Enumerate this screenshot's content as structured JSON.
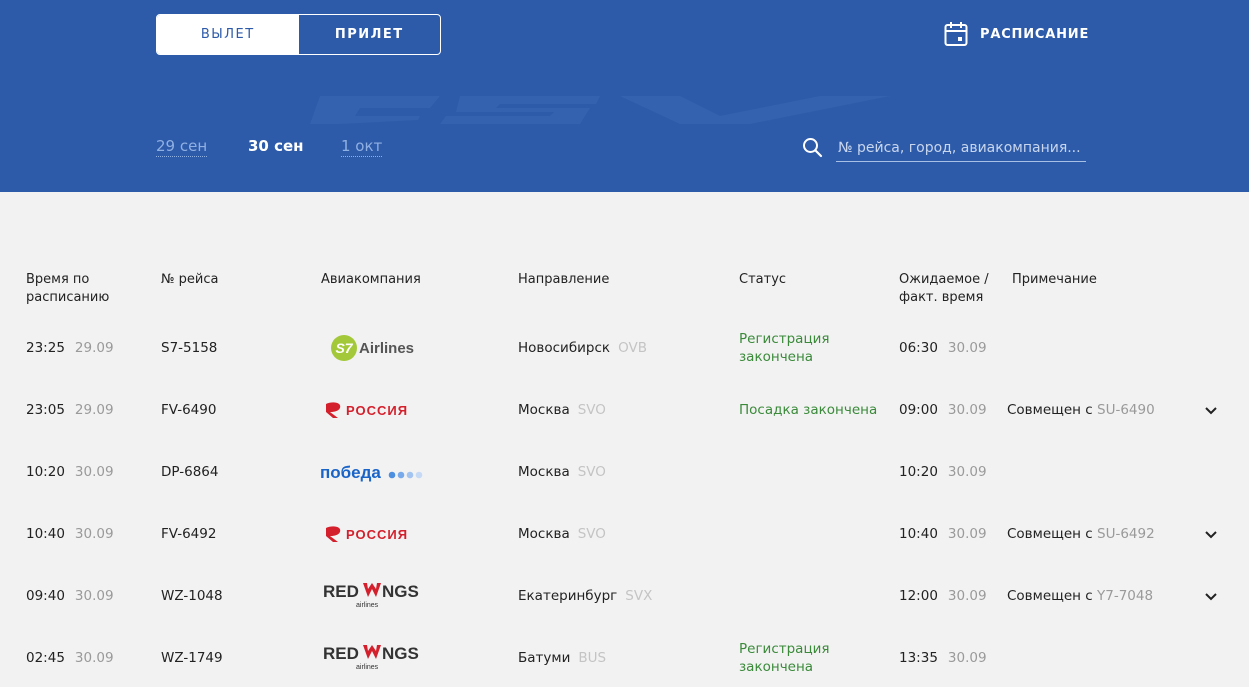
{
  "header": {
    "mode_tabs": [
      {
        "label": "ВЫЛЕТ",
        "active": true
      },
      {
        "label": "ПРИЛЕТ",
        "active": false
      }
    ],
    "schedule_label": "РАСПИСАНИЕ",
    "dates": [
      {
        "label": "29 сен",
        "active": false
      },
      {
        "label": "30 сен",
        "active": true
      },
      {
        "label": "1 окт",
        "active": false
      }
    ],
    "search_placeholder": "№ рейса, город, авиакомпания...",
    "colors": {
      "background": "#2e5ba9",
      "date_muted": "#8fb0e3"
    }
  },
  "table": {
    "columns": {
      "scheduled": "Время по расписанию",
      "flight": "№ рейса",
      "airline": "Авиакомпания",
      "direction": "Направление",
      "status": "Статус",
      "actual": "Ожидаемое / факт. время",
      "note": "Примечание"
    },
    "rows": [
      {
        "sched_time": "23:25",
        "sched_date": "29.09",
        "flight": "S7-5158",
        "airline_logo": "s7-airlines-logo",
        "city": "Новосибирск",
        "code": "OVB",
        "status": "Регистрация закончена",
        "act_time": "06:30",
        "act_date": "30.09",
        "note_prefix": "",
        "note_code": "",
        "expandable": false
      },
      {
        "sched_time": "23:05",
        "sched_date": "29.09",
        "flight": "FV-6490",
        "airline_logo": "rossiya-logo",
        "city": "Москва",
        "code": "SVO",
        "status": "Посадка закончена",
        "act_time": "09:00",
        "act_date": "30.09",
        "note_prefix": "Совмещен с ",
        "note_code": "SU-6490",
        "expandable": true
      },
      {
        "sched_time": "10:20",
        "sched_date": "30.09",
        "flight": "DP-6864",
        "airline_logo": "pobeda-logo",
        "city": "Москва",
        "code": "SVO",
        "status": "",
        "act_time": "10:20",
        "act_date": "30.09",
        "note_prefix": "",
        "note_code": "",
        "expandable": false
      },
      {
        "sched_time": "10:40",
        "sched_date": "30.09",
        "flight": "FV-6492",
        "airline_logo": "rossiya-logo",
        "city": "Москва",
        "code": "SVO",
        "status": "",
        "act_time": "10:40",
        "act_date": "30.09",
        "note_prefix": "Совмещен с ",
        "note_code": "SU-6492",
        "expandable": true
      },
      {
        "sched_time": "09:40",
        "sched_date": "30.09",
        "flight": "WZ-1048",
        "airline_logo": "redwings-logo",
        "city": "Екатеринбург",
        "code": "SVX",
        "status": "",
        "act_time": "12:00",
        "act_date": "30.09",
        "note_prefix": "Совмещен с ",
        "note_code": "Y7-7048",
        "expandable": true
      },
      {
        "sched_time": "02:45",
        "sched_date": "30.09",
        "flight": "WZ-1749",
        "airline_logo": "redwings-logo",
        "city": "Батуми",
        "code": "BUS",
        "status": "Регистрация закончена",
        "act_time": "13:35",
        "act_date": "30.09",
        "note_prefix": "",
        "note_code": "",
        "expandable": false
      }
    ]
  },
  "logos": {
    "s7": {
      "mark": "S7",
      "word": "Airlines",
      "color": "#a3c93a"
    },
    "rossiya": {
      "word": "РОССИЯ",
      "color": "#d4202c"
    },
    "pobeda": {
      "word": "победа",
      "color": "#1a64c8"
    },
    "redwings": {
      "word_left": "RED",
      "word_right": "NGS",
      "sub": "airlines",
      "color": "#d4202c"
    }
  }
}
